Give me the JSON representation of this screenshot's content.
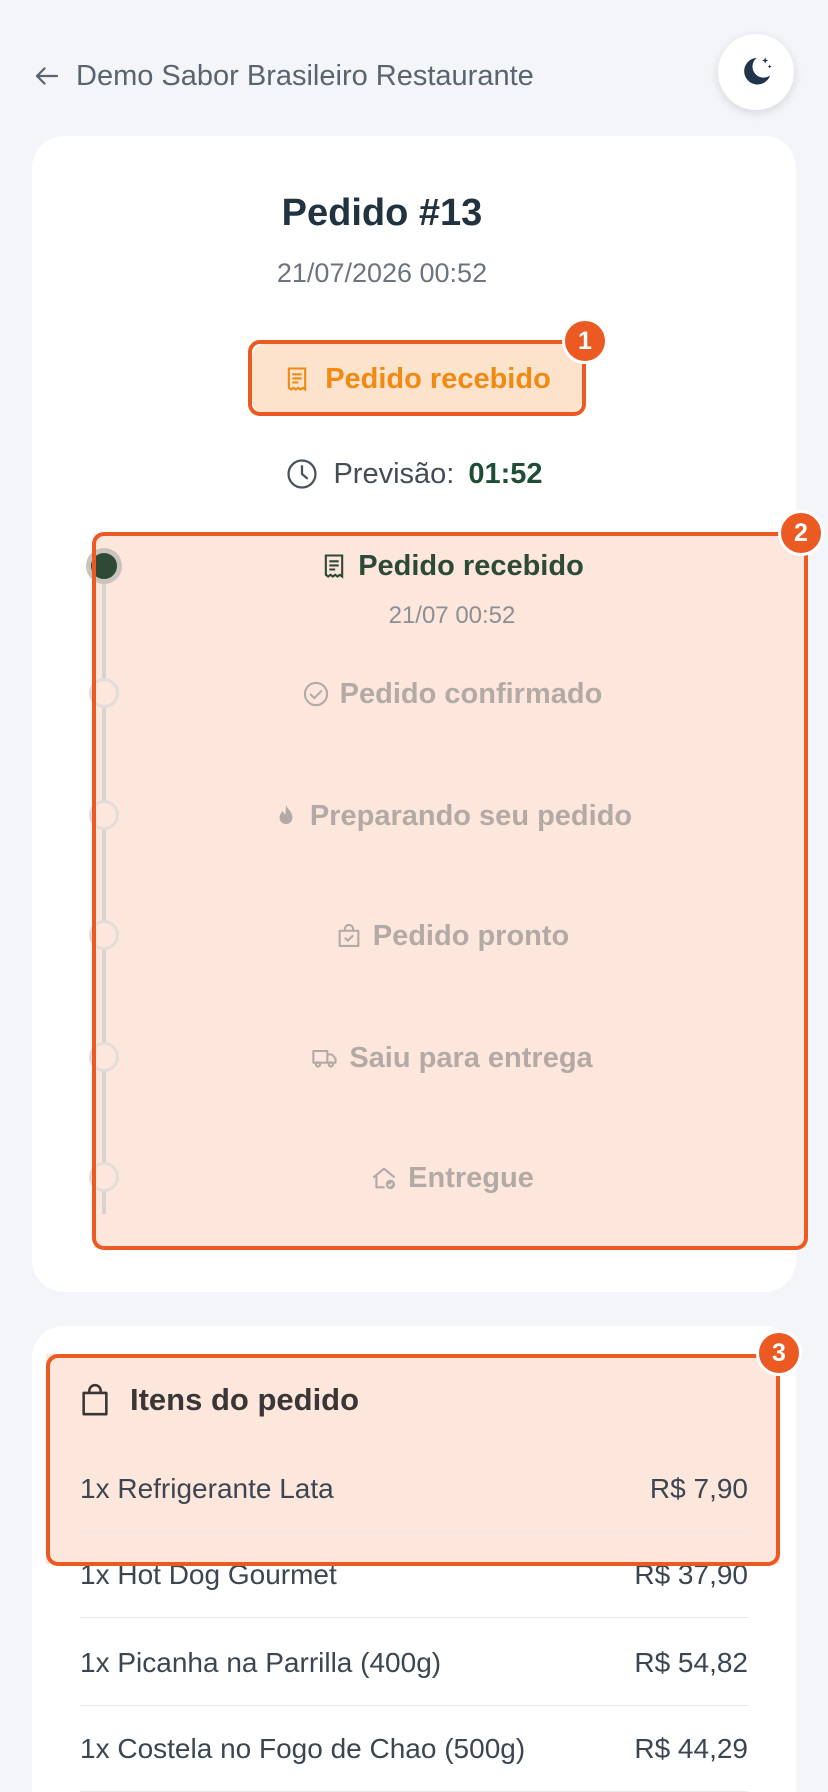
{
  "header": {
    "back_label": "Demo Sabor Brasileiro Restaurante",
    "theme_icon": "moon-stars-icon"
  },
  "order": {
    "title": "Pedido #13",
    "datetime": "21/07/2026 00:52",
    "status_label": "Pedido recebido",
    "forecast_label": "Previsão:",
    "forecast_time": "01:52"
  },
  "timeline": {
    "steps": [
      {
        "label": "Pedido recebido",
        "time": "21/07 00:52",
        "icon": "receipt-icon",
        "active": true
      },
      {
        "label": "Pedido confirmado",
        "icon": "check-circle-icon",
        "active": false
      },
      {
        "label": "Preparando seu pedido",
        "icon": "flame-icon",
        "active": false
      },
      {
        "label": "Pedido pronto",
        "icon": "bag-check-icon",
        "active": false
      },
      {
        "label": "Saiu para entrega",
        "icon": "truck-icon",
        "active": false
      },
      {
        "label": "Entregue",
        "icon": "house-check-icon",
        "active": false
      }
    ]
  },
  "items": {
    "header": "Itens do pedido",
    "rows": [
      {
        "name": "1x Refrigerante Lata",
        "price": "R$ 7,90"
      },
      {
        "name": "1x Hot Dog Gourmet",
        "price": "R$ 37,90"
      },
      {
        "name": "1x Picanha na Parrilla (400g)",
        "price": "R$ 54,82"
      },
      {
        "name": "1x Costela no Fogo de Chao (500g)",
        "price": "R$ 44,29"
      }
    ]
  },
  "annotations": [
    "1",
    "2",
    "3"
  ],
  "colors": {
    "accent": "#ea5a22",
    "status_orange": "#ef8a12",
    "active_green": "#2c4a36"
  }
}
